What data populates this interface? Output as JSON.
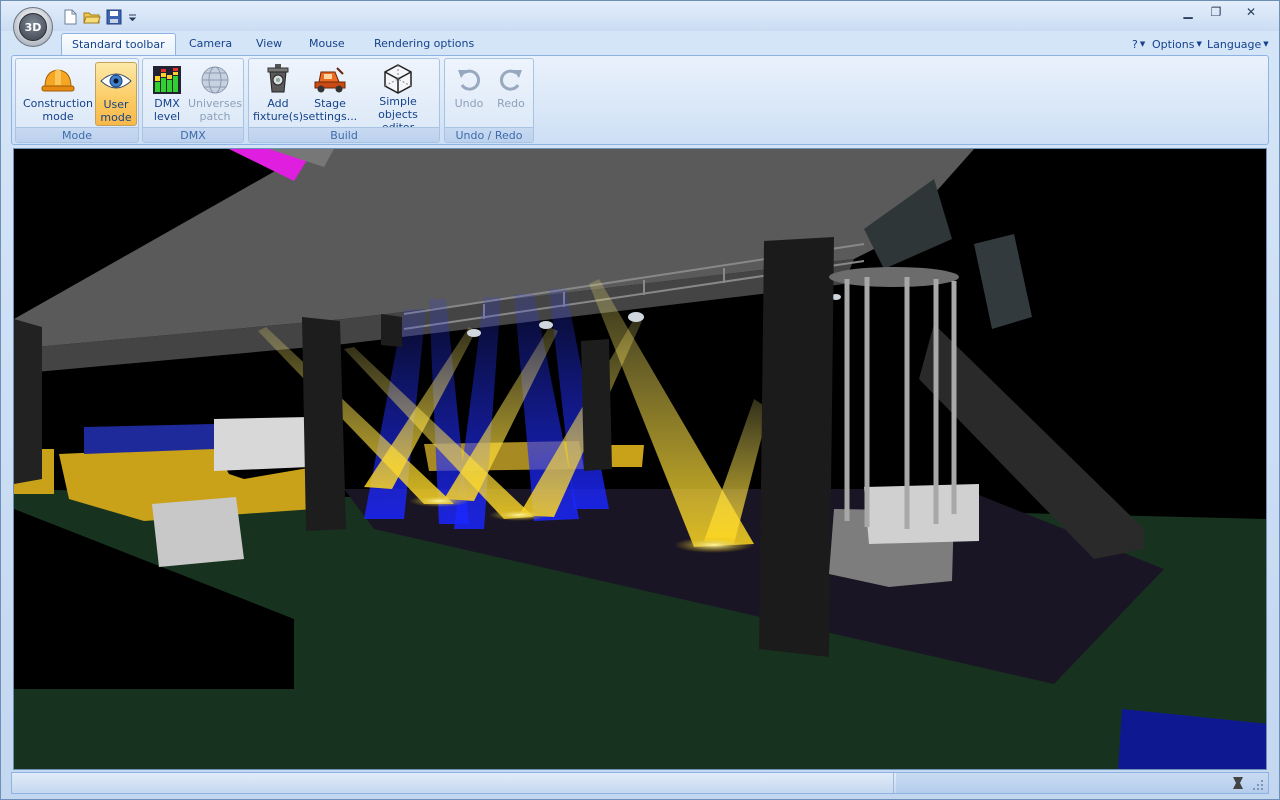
{
  "app": {
    "orb_label": "3D"
  },
  "quick_access": {
    "items": [
      "new-document-icon",
      "open-folder-icon",
      "save-icon",
      "customize-dropdown-icon"
    ]
  },
  "window_controls": {
    "minimize": "▁",
    "maximize": "❐",
    "close": "✕"
  },
  "tabs": [
    {
      "label": "Standard toolbar",
      "active": true
    },
    {
      "label": "Camera",
      "active": false
    },
    {
      "label": "View",
      "active": false
    },
    {
      "label": "Mouse",
      "active": false
    },
    {
      "label": "Rendering options",
      "active": false
    }
  ],
  "right_menu": {
    "help": "?",
    "options": "Options",
    "language": "Language"
  },
  "groups": {
    "mode": {
      "label": "Mode",
      "buttons": [
        {
          "label": "Construction\nmode",
          "icon": "hard-hat-icon",
          "active": false
        },
        {
          "label": "User\nmode",
          "icon": "eye-icon",
          "active": true
        }
      ]
    },
    "dmx": {
      "label": "DMX",
      "buttons": [
        {
          "label": "DMX\nlevel",
          "icon": "level-meter-icon"
        },
        {
          "label": "Universes\npatch",
          "icon": "dmx-globe-icon",
          "disabled": true
        }
      ]
    },
    "build": {
      "label": "Build",
      "buttons": [
        {
          "label": "Add\nfixture(s)",
          "icon": "fixture-icon"
        },
        {
          "label": "Stage\nsettings...",
          "icon": "stage-truck-icon"
        },
        {
          "label": "Simple objects\neditor",
          "icon": "cube-icon"
        }
      ]
    },
    "undo_redo": {
      "label": "Undo / Redo",
      "buttons": [
        {
          "label": "Undo",
          "icon": "undo-icon",
          "disabled": true
        },
        {
          "label": "Redo",
          "icon": "redo-icon",
          "disabled": true
        }
      ]
    }
  },
  "colors": {
    "beam_blue": "#1f2dff",
    "beam_yellow": "#ffe23a",
    "floor_green": "#17331f",
    "sofa_yellow": "#c9a21a",
    "truss_magenta": "#e01ee0"
  }
}
